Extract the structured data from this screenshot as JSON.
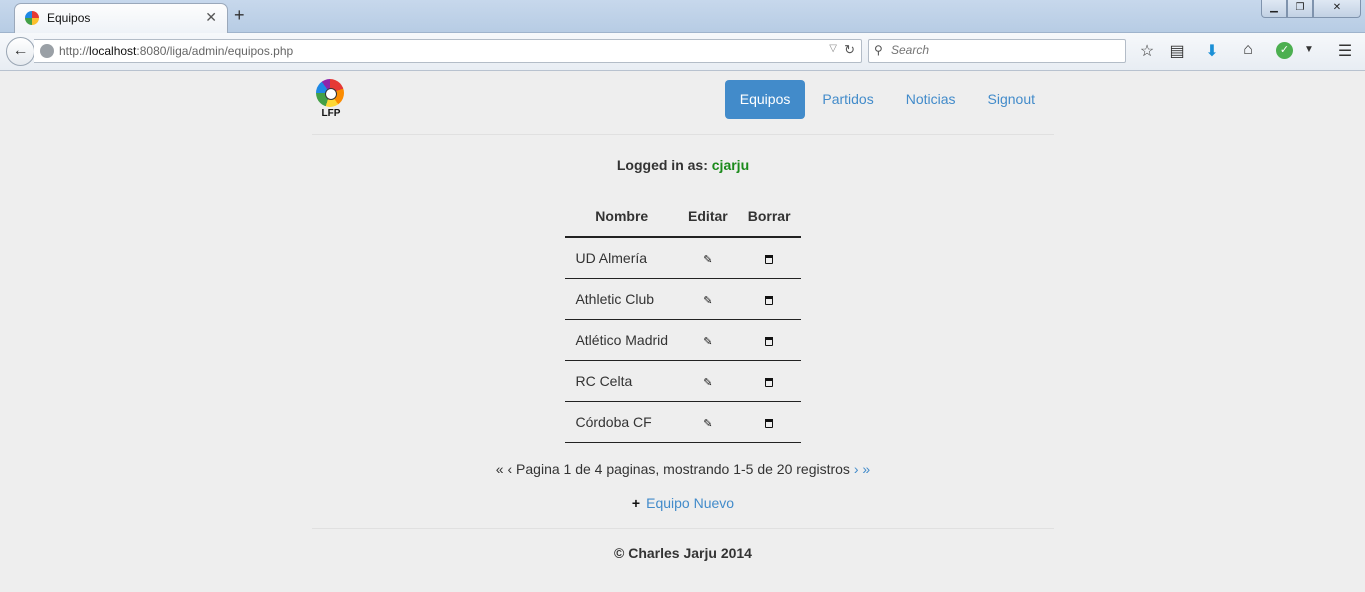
{
  "browser": {
    "tab_title": "Equipos",
    "url_prefix": "http://",
    "url_host": "localhost",
    "url_rest": ":8080/liga/admin/equipos.php",
    "search_placeholder": "Search"
  },
  "header": {
    "logo_text": "LFP",
    "nav": [
      {
        "label": "Equipos",
        "active": true
      },
      {
        "label": "Partidos",
        "active": false
      },
      {
        "label": "Noticias",
        "active": false
      },
      {
        "label": "Signout",
        "active": false
      }
    ]
  },
  "login": {
    "prefix": "Logged in as:",
    "username": "cjarju"
  },
  "table": {
    "columns": [
      "Nombre",
      "Editar",
      "Borrar"
    ],
    "rows": [
      "UD Almería",
      "Athletic Club",
      "Atlético Madrid",
      "RC Celta",
      "Córdoba CF"
    ]
  },
  "pager": {
    "first": "«",
    "prev": "‹",
    "text": "Pagina 1 de 4 paginas, mostrando 1-5 de 20 registros",
    "next": "›",
    "last": "»"
  },
  "new_team": "Equipo Nuevo",
  "footer": "© Charles Jarju 2014",
  "colors": {
    "accent": "#428bca",
    "username": "#1a8a1a"
  }
}
